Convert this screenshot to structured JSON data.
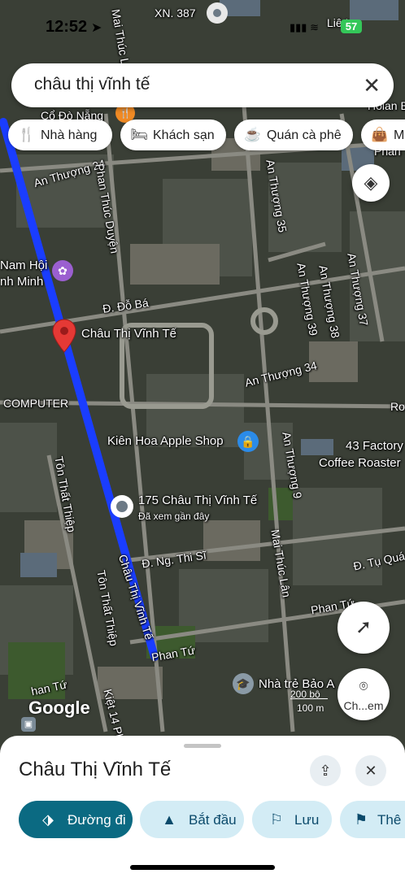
{
  "status_bar": {
    "time": "12:52",
    "battery": "57"
  },
  "search": {
    "query": "châu thị vĩnh tế"
  },
  "chips": [
    {
      "label": "Nhà hàng",
      "icon": "fork-knife-icon"
    },
    {
      "label": "Khách sạn",
      "icon": "bed-icon"
    },
    {
      "label": "Quán cà phê",
      "icon": "coffee-cup-icon"
    },
    {
      "label": "Mu",
      "icon": "shopping-bag-icon"
    }
  ],
  "map": {
    "labels": {
      "xn387": "XN. 387",
      "co_do_nang": "Cổ Đò Nẵng",
      "mai_thuc_lan_top": "Mai Thúc Lân",
      "phan_thuc_duyen": "Phan Thúc Duyện",
      "an_thuong_24": "An Thượng 24",
      "an_thuong_35": "An Thượng 35",
      "an_thuong_37": "An Thượng 37",
      "an_thuong_38": "An Thượng 38",
      "an_thuong_39": "An Thượng 39",
      "an_thuong_34": "An Thượng 34",
      "an_thuong_9": "An Thượng 9",
      "d_do_ba": "Đ. Đỗ Bá",
      "nam_hoi": "Nam Hội",
      "nh_minh": "nh Minh",
      "computer": "COMPUTER",
      "ton_that_thiep_1": "Tôn Thất Thiệp",
      "ton_that_thiep_2": "Tôn Thất Thiệp",
      "chau_thi_vinh_te_road": "Châu Thị Vĩnh Tế",
      "d_ng_thi_si": "Đ. Ng. Thi Sĩ",
      "mai_thuc_lan": "Mai Thúc Lân",
      "d_tu_qua": "Đ. Tụ Quá",
      "phan_tu_1": "Phan Tứ",
      "phan_tu_2": "Phan Tứ",
      "han_tu": "han Tứ",
      "kiet_14": "Kiệt 14 Ph",
      "phan_ton": "Phan Tôn",
      "ro": "Ro",
      "lie_l": "Liê L",
      "hoian": "Hoian B"
    },
    "pins": {
      "selected": "Châu Thị Vĩnh Tế",
      "address_pin": "175 Châu Thị Vĩnh Tế",
      "address_sub": "Đã xem gần đây",
      "apple_shop": "Kiên Hoa Apple Shop",
      "coffee_line1": "43 Factory",
      "coffee_line2": "Coffee Roaster",
      "nha_tre": "Nhà trẻ Bảo A"
    },
    "scale": {
      "top": "200 bộ",
      "bottom": "100 m"
    },
    "attribution": "Google",
    "camera_button": "Ch...em"
  },
  "sheet": {
    "title": "Châu Thị Vĩnh Tế",
    "actions": [
      {
        "label": "Đường đi",
        "icon": "directions-icon",
        "primary": true
      },
      {
        "label": "Bắt đầu",
        "icon": "navigation-arrow-icon",
        "primary": false
      },
      {
        "label": "Lưu",
        "icon": "bookmark-icon",
        "primary": false
      },
      {
        "label": "Thê",
        "icon": "flag-icon",
        "primary": false
      }
    ]
  },
  "colors": {
    "route": "#1a3dff",
    "pin": "#e53935",
    "primary_action": "#0b6a82",
    "secondary_action": "#d3ecf5"
  }
}
